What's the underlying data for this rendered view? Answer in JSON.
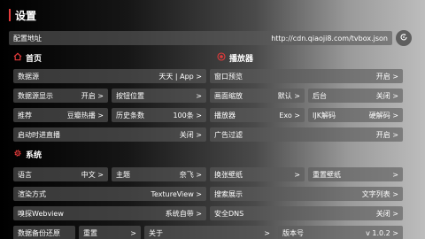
{
  "header": {
    "title": "设置"
  },
  "config": {
    "label": "配置地址",
    "url": "http://cdn.qiaoji8.com/tvbox.json"
  },
  "icons": {
    "home": "home-icon",
    "player": "record-icon",
    "system": "gear-icon",
    "refresh": "refresh-icon"
  },
  "colors": {
    "accent": "#e33b3b"
  },
  "home": {
    "title": "首页",
    "source": {
      "label": "数据源",
      "value": "天天 | App"
    },
    "data_display": {
      "label": "数据源显示",
      "value": "开启"
    },
    "button_position": {
      "label": "按钮位置",
      "value": ""
    },
    "recommend": {
      "label": "推荐",
      "value": "豆瓣热播"
    },
    "history": {
      "label": "历史条数",
      "value": "100条"
    },
    "live_on_start": {
      "label": "启动时进直播",
      "value": "关闭"
    }
  },
  "player": {
    "title": "播放器",
    "window_preview": {
      "label": "窗口预览",
      "value": "开启"
    },
    "scale": {
      "label": "画面缩放",
      "value": "默认"
    },
    "background": {
      "label": "后台",
      "value": "关闭"
    },
    "player": {
      "label": "播放器",
      "value": "Exo"
    },
    "ijk_decode": {
      "label": "IJK解码",
      "value": "硬解码"
    },
    "ad_filter": {
      "label": "广告过滤",
      "value": "开启"
    }
  },
  "system": {
    "title": "系统",
    "language": {
      "label": "语言",
      "value": "中文"
    },
    "theme": {
      "label": "主题",
      "value": "奈飞"
    },
    "change_wallpaper": {
      "label": "换张壁纸",
      "value": ""
    },
    "reset_wallpaper": {
      "label": "重置壁纸",
      "value": ""
    },
    "render": {
      "label": "渲染方式",
      "value": "TextureView"
    },
    "search_display": {
      "label": "搜索展示",
      "value": "文字列表"
    },
    "sniff": {
      "label": "嗅探Webview",
      "value": "系统自带"
    },
    "safe_dns": {
      "label": "安全DNS",
      "value": "关闭"
    },
    "backup": {
      "label": "数据备份还原",
      "value": ""
    },
    "reset": {
      "label": "重置",
      "value": ""
    },
    "about": {
      "label": "关于",
      "value": ""
    },
    "version": {
      "label": "版本号",
      "value": "v 1.0.2"
    }
  }
}
